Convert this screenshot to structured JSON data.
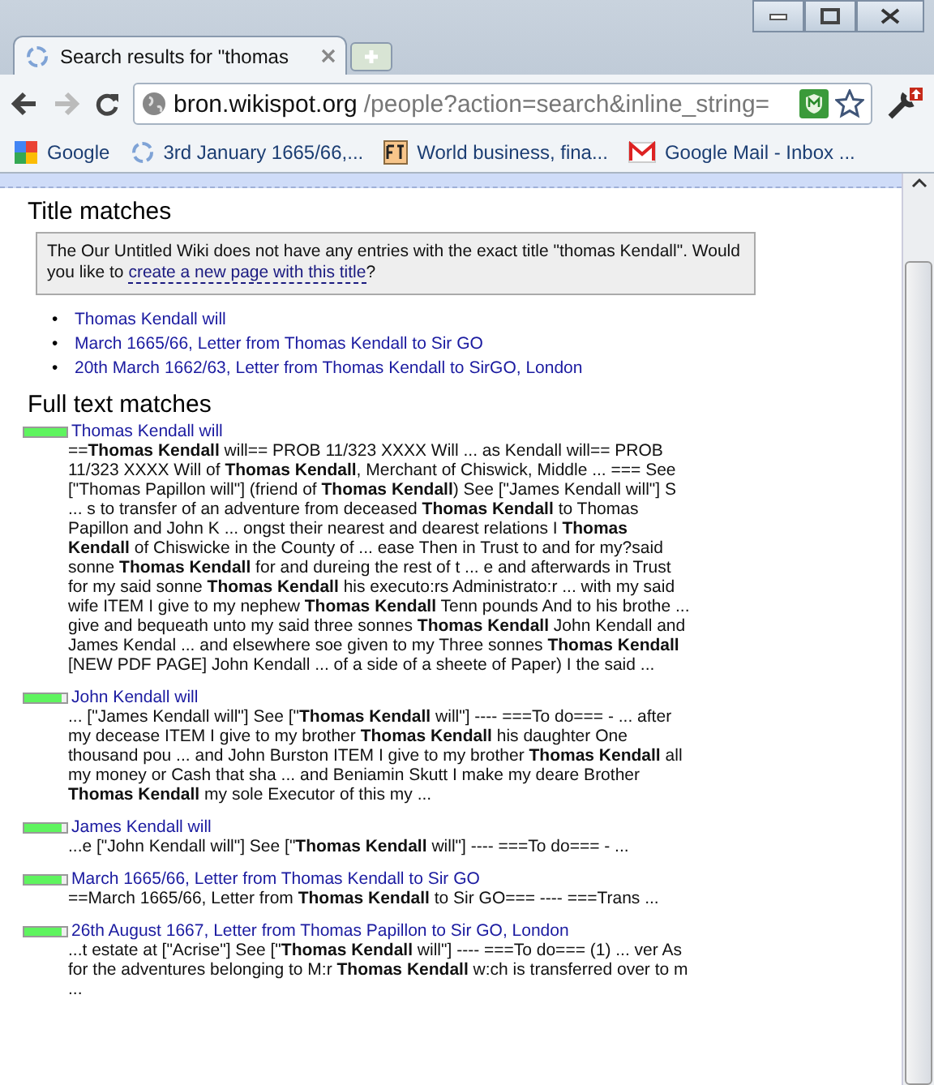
{
  "tabs": [
    {
      "title": "Search results for \"thomas",
      "selected": true
    }
  ],
  "address": {
    "host": "bron.wikispot.org",
    "path": "/people?action=search&inline_string="
  },
  "bookmarks": [
    {
      "label": "Google",
      "kind": "google"
    },
    {
      "label": "3rd January 1665/66,...",
      "kind": "wiki"
    },
    {
      "label": "World business, fina...",
      "kind": "ft"
    },
    {
      "label": "Google Mail - Inbox ...",
      "kind": "mail"
    }
  ],
  "title_matches": {
    "heading": "Title matches",
    "notice": {
      "text": "The Our Untitled Wiki does not have any entries with the exact title \"thomas Kendall\". Would you like to ",
      "link": "create a new page with this title",
      "after": "?"
    },
    "marker": "•",
    "items": [
      "Thomas Kendall will",
      "March 1665/66, Letter from Thomas Kendall to Sir GO",
      "20th March 1662/63, Letter from Thomas Kendall to SirGO, London"
    ]
  },
  "full_text_matches": {
    "heading": "Full text matches",
    "results": [
      {
        "title": "Thomas Kendall will",
        "level": 1,
        "snippet": "==**Thomas Kendall** will== PROB 11/323 XXXX Will ... as Kendall will== PROB 11/323 XXXX Will of **Thomas Kendall**, Merchant of Chiswick, Middle ... === See [\"Thomas Papillon will\"] (friend of **Thomas Kendall**) See [\"James Kendall will\"] S ... s to transfer of an adventure from deceased **Thomas Kendall** to Thomas Papillon and John K ... ongst their nearest and dearest relations I **Thomas Kendall** of Chiswicke in the County of ... ease Then in Trust to and for my?said sonne **Thomas Kendall** for and dureing the rest of t ... e and afterwards in Trust for my said sonne **Thomas Kendall** his executo:rs Administrato:r ... with my said wife ITEM I give to my nephew **Thomas Kendall** Tenn pounds And to his brothe ... give and bequeath unto my said three sonnes **Thomas Kendall** John Kendall and James Kendal ... and elsewhere soe given to my Three sonnes **Thomas Kendall** [NEW PDF PAGE] John Kendall ... of a side of a sheete of Paper) I the said ..."
      },
      {
        "title": "John Kendall will",
        "level": 0.9,
        "snippet": "... [\"James Kendall will\"] See [\"**Thomas Kendall** will\"] ---- ===To do=== - ... after my decease ITEM I give to my brother **Thomas Kendall** his daughter One thousand pou ... and John Burston ITEM I give to my brother **Thomas Kendall** all my money or Cash that sha ... and Beniamin Skutt I make my deare Brother **Thomas Kendall** my sole Executor of this my ..."
      },
      {
        "title": "James Kendall will",
        "level": 0.9,
        "snippet": "...e [\"John Kendall will\"] See [\"**Thomas Kendall** will\"] ---- ===To do=== - ..."
      },
      {
        "title": "March 1665/66, Letter from Thomas Kendall to Sir GO",
        "level": 0.88,
        "snippet": "==March 1665/66, Letter from **Thomas Kendall** to Sir GO=== ---- ===Trans ..."
      },
      {
        "title": "26th August 1667, Letter from Thomas Papillon to Sir GO, London",
        "level": 0.88,
        "snippet": "...t estate at [\"Acrise\"] See [\"**Thomas Kendall** will\"] ---- ===To do=== (1) ... ver As for the adventures belonging to M:r **Thomas Kendall** w:ch is transferred over to m ..."
      }
    ]
  }
}
